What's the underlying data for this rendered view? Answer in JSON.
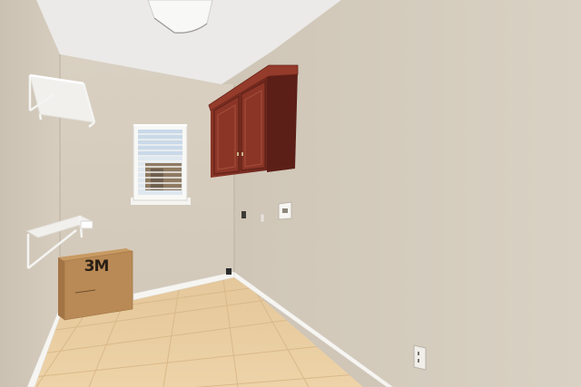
{
  "scene": {
    "box": {
      "logo_text": "3M"
    }
  },
  "colors": {
    "wall": "#d8cfc1",
    "wall_right": "#d3cabb",
    "ceiling": "#ecebe9",
    "floor_tile": "#e8cc9f",
    "cabinet": "#7a2c22",
    "box": "#b98a55",
    "trim": "#f7f6f3"
  }
}
